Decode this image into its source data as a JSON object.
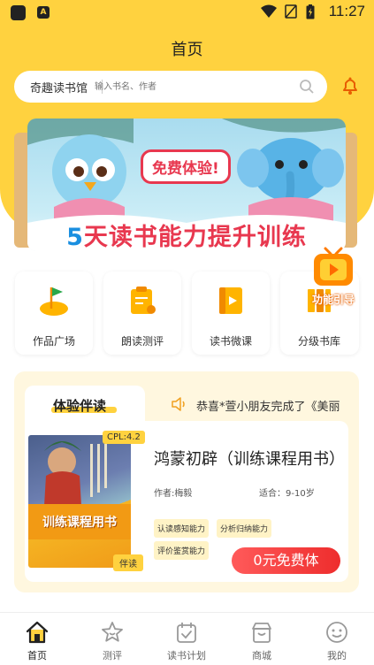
{
  "status_bar": {
    "time": "11:27"
  },
  "header": {
    "title": "首页"
  },
  "search": {
    "library_name": "奇趣读书馆",
    "placeholder": "输入书名、作者"
  },
  "banner": {
    "badge": "免费体验!",
    "slogan_number": "5",
    "slogan_rest": "天读书能力提升训练"
  },
  "quick_actions": [
    {
      "label": "作品广场",
      "icon": "flag-icon"
    },
    {
      "label": "朗读测评",
      "icon": "clipboard-icon"
    },
    {
      "label": "读书微课",
      "icon": "book-icon"
    },
    {
      "label": "分级书库",
      "icon": "library-icon"
    }
  ],
  "guide": {
    "label": "功能引导"
  },
  "trial": {
    "title": "体验伴读",
    "ticker": "恭喜*萱小朋友完成了《美丽",
    "book": {
      "cover_title": "训练课程用书",
      "cpl": "CPL:4.2",
      "tag": "伴读",
      "name": "鸿蒙初辟（训练课程用书）",
      "author": "作者:梅毅",
      "age": "适合：9-10岁",
      "skills": [
        "认读感知能力",
        "分析归纳能力",
        "评价鉴赏能力"
      ]
    },
    "cta": "0元免费体"
  },
  "tabbar": [
    {
      "label": "首页",
      "icon": "home-icon",
      "active": true
    },
    {
      "label": "测评",
      "icon": "star-icon",
      "active": false
    },
    {
      "label": "读书计划",
      "icon": "calendar-icon",
      "active": false
    },
    {
      "label": "商城",
      "icon": "shop-icon",
      "active": false
    },
    {
      "label": "我的",
      "icon": "profile-icon",
      "active": false
    }
  ],
  "colors": {
    "brand_yellow": "#ffd23f",
    "accent_red": "#ee2d2d",
    "banner_sky": "#a9dcef"
  }
}
